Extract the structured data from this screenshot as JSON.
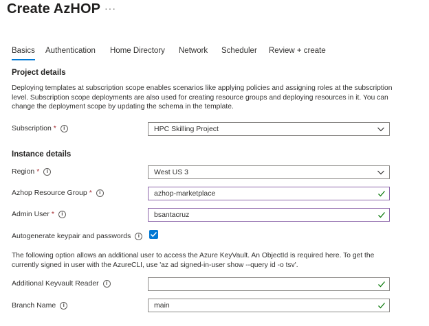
{
  "header": {
    "title": "Create AzHOP",
    "more_label": "···"
  },
  "tabs": [
    {
      "label": "Basics",
      "active": true
    },
    {
      "label": "Authentication"
    },
    {
      "label": "Home Directory"
    },
    {
      "label": "Network"
    },
    {
      "label": "Scheduler"
    },
    {
      "label": "Review + create"
    }
  ],
  "project": {
    "heading": "Project details",
    "description": "Deploying templates at subscription scope enables scenarios like applying policies and assigning roles at the subscription level. Subscription scope deployments are also used for creating resource groups and deploying resources in it. You can change the deployment scope by updating the schema in the template.",
    "subscription": {
      "label": "Subscription",
      "required": "*",
      "value": "HPC Skilling Project"
    }
  },
  "instance": {
    "heading": "Instance details",
    "region": {
      "label": "Region",
      "required": "*",
      "value": "West US 3"
    },
    "resource_group": {
      "label": "Azhop Resource Group",
      "required": "*",
      "value": "azhop-marketplace"
    },
    "admin_user": {
      "label": "Admin User",
      "required": "*",
      "value": "bsantacruz"
    },
    "autogenerate": {
      "label": "Autogenerate keypair and passwords",
      "checked": true
    },
    "keyvault_note": "The following option allows an additional user to access the Azure KeyVault. An ObjectId is required here. To get the currently signed in user with the AzureCLI, use 'az ad signed-in-user show --query id -o tsv'.",
    "keyvault_reader": {
      "label": "Additional Keyvault Reader",
      "value": ""
    },
    "branch": {
      "label": "Branch Name",
      "value": "main"
    }
  },
  "colors": {
    "accent": "#0078d4",
    "valid_border": "#8a63a8",
    "check": "#107c10",
    "required": "#a4262c"
  },
  "icons": {
    "info": "info-icon",
    "dropdown": "chevron-down-icon",
    "valid": "checkmark-icon"
  }
}
